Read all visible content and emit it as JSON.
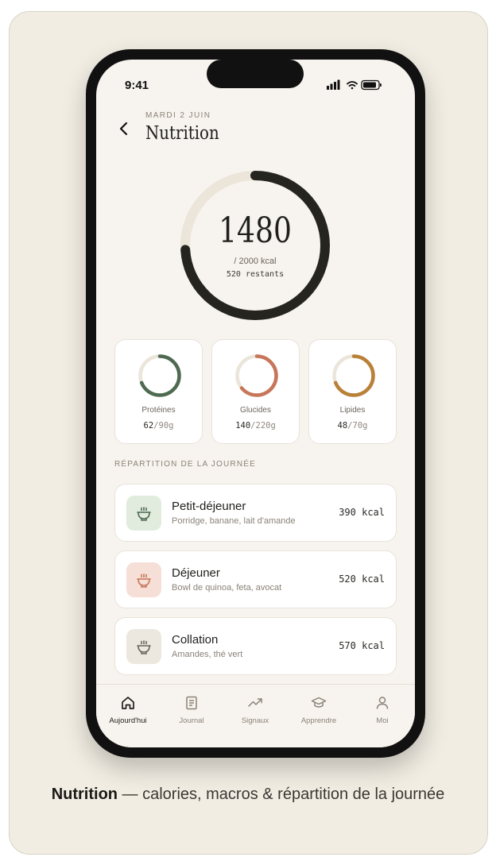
{
  "status_bar": {
    "time": "9:41"
  },
  "header": {
    "date": "MARDI 2 JUIN",
    "title": "Nutrition"
  },
  "calories": {
    "consumed": "1480",
    "goal_text": "/ 2000 kcal",
    "remaining_text": "520 restants",
    "progress": 0.74
  },
  "macros": [
    {
      "name": "Protéines",
      "value": "62",
      "goal": "/90g",
      "progress": 0.69,
      "color": "#4e6b52"
    },
    {
      "name": "Glucides",
      "value": "140",
      "goal": "/220g",
      "progress": 0.64,
      "color": "#c7765a"
    },
    {
      "name": "Lipides",
      "value": "48",
      "goal": "/70g",
      "progress": 0.69,
      "color": "#b98037"
    }
  ],
  "meals_section": {
    "title": "RÉPARTITION DE LA JOURNÉE"
  },
  "meals": [
    {
      "name": "Petit-déjeuner",
      "desc": "Porridge, banane, lait d'amande",
      "kcal": "390 kcal",
      "icon": "bowl-icon",
      "bg": "#e1ebde",
      "color": "#4e6b52"
    },
    {
      "name": "Déjeuner",
      "desc": "Bowl de quinoa, feta, avocat",
      "kcal": "520 kcal",
      "icon": "bowl-icon",
      "bg": "#f5dfd6",
      "color": "#c7765a"
    },
    {
      "name": "Collation",
      "desc": "Amandes, thé vert",
      "kcal": "570 kcal",
      "icon": "bowl-icon",
      "bg": "#ece8df",
      "color": "#6c665d"
    }
  ],
  "tabs": [
    {
      "label": "Aujourd'hui",
      "icon": "home-icon",
      "active": true
    },
    {
      "label": "Journal",
      "icon": "journal-icon",
      "active": false
    },
    {
      "label": "Signaux",
      "icon": "trend-icon",
      "active": false
    },
    {
      "label": "Apprendre",
      "icon": "graduation-cap-icon",
      "active": false
    },
    {
      "label": "Moi",
      "icon": "user-icon",
      "active": false
    }
  ],
  "caption": {
    "bold": "Nutrition",
    "rest": " — calories, macros & répartition de la journée"
  }
}
